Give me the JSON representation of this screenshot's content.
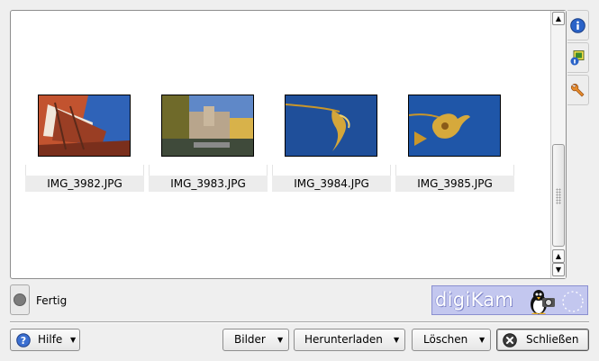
{
  "thumbnails": [
    {
      "filename": "IMG_3982.JPG"
    },
    {
      "filename": "IMG_3983.JPG"
    },
    {
      "filename": "IMG_3984.JPG"
    },
    {
      "filename": "IMG_3985.JPG"
    }
  ],
  "sidebar_tabs": [
    {
      "icon": "info-icon"
    },
    {
      "icon": "image-properties-icon"
    },
    {
      "icon": "tools-wrench-icon"
    }
  ],
  "status": {
    "text": "Fertig",
    "indicator": "status-led-icon",
    "indicator_color": "#7c7c7c"
  },
  "logo": {
    "text": "digiKam",
    "background": "#c3c7ef"
  },
  "buttons": {
    "help_label": "Hilfe",
    "images_label": "Bilder",
    "download_label": "Herunterladen",
    "delete_label": "Löschen",
    "close_label": "Schließen"
  },
  "colors": {
    "sky_blue": "#1f4f9a",
    "help_icon": "#3b6fd1",
    "window_bg": "#efefef"
  }
}
